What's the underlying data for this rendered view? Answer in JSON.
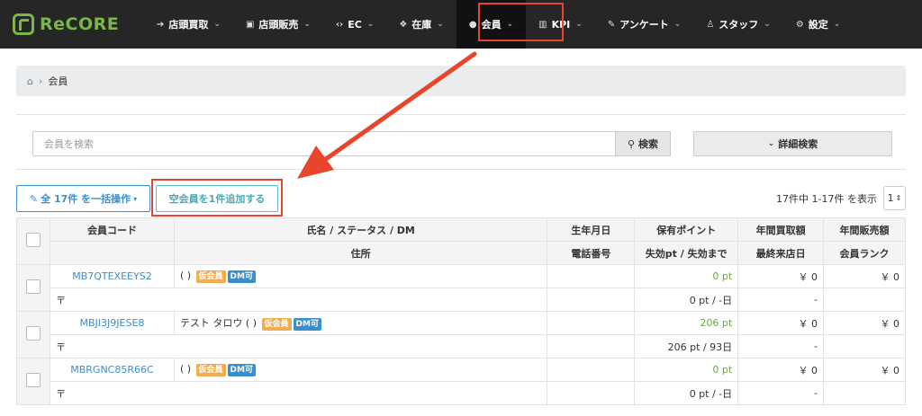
{
  "app": {
    "logo_text": "ReCORE"
  },
  "nav": [
    {
      "icon": "sign-in-icon",
      "glyph": "➔",
      "label": "店頭買取"
    },
    {
      "icon": "cart-icon",
      "glyph": "🛒",
      "label": "店頭販売"
    },
    {
      "icon": "code-icon",
      "glyph": "‹›",
      "label": "EC"
    },
    {
      "icon": "cubes-icon",
      "glyph": "❖",
      "label": "在庫"
    },
    {
      "icon": "user-icon",
      "glyph": "👤",
      "label": "会員"
    },
    {
      "icon": "bar-chart-icon",
      "glyph": "▥",
      "label": "KPI"
    },
    {
      "icon": "edit-icon",
      "glyph": "✎",
      "label": "アンケート"
    },
    {
      "icon": "user-icon",
      "glyph": "♙",
      "label": "スタッフ"
    },
    {
      "icon": "gear-icon",
      "glyph": "⚙",
      "label": "設定"
    }
  ],
  "breadcrumb": {
    "current": "会員"
  },
  "search": {
    "placeholder": "会員を検索",
    "button": "検索",
    "advanced": "詳細検索"
  },
  "toolbar": {
    "bulk_label": "全 17件 を一括操作",
    "add_label": "空会員を1件追加する",
    "paging_text": "17件中 1-17件 を表示",
    "page_value": "1"
  },
  "table": {
    "headers_top": [
      "会員コード",
      "氏名 / ステータス / DM",
      "生年月日",
      "保有ポイント",
      "年間買取額",
      "年間販売額"
    ],
    "headers_bottom": [
      "住所",
      "電話番号",
      "失効pt / 失効まで",
      "最終来店日",
      "会員ランク"
    ],
    "rows": [
      {
        "code": "MB7QTEXEEYS2",
        "name": "( )",
        "status": "仮会員",
        "dm": "DM可",
        "points": "0 pt",
        "buy": "￥ 0",
        "sell": "￥ 0",
        "postal": "〒",
        "expire": "0 pt / -日",
        "last_visit": "-"
      },
      {
        "code": "MBJI3J9JESE8",
        "name": "テスト タロウ ( )",
        "status": "仮会員",
        "dm": "DM可",
        "points": "206 pt",
        "buy": "￥ 0",
        "sell": "￥ 0",
        "postal": "〒",
        "expire": "206 pt / 93日",
        "last_visit": "-"
      },
      {
        "code": "MBRGNC85R66C",
        "name": "( )",
        "status": "仮会員",
        "dm": "DM可",
        "points": "0 pt",
        "buy": "￥ 0",
        "sell": "￥ 0",
        "postal": "〒",
        "expire": "0 pt / -日",
        "last_visit": "-"
      }
    ]
  },
  "colors": {
    "accent": "#3a8ec9",
    "highlight": "#e8452c",
    "brand": "#7ab648"
  }
}
